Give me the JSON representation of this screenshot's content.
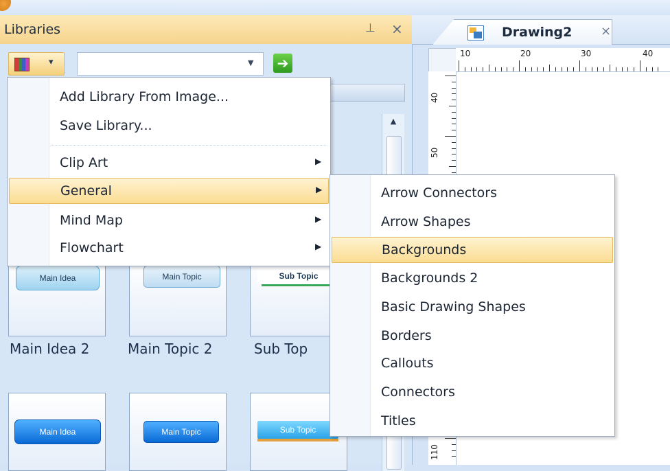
{
  "libraries_panel": {
    "title": "Libraries",
    "pin_icon": "pin-icon",
    "close_icon": "close-icon",
    "toolbar": {
      "library_icon": "library-icon",
      "search_value": "",
      "go_icon": "go-arrow-icon"
    }
  },
  "library_tiles": {
    "row1": [
      {
        "shape_text": "Main Idea"
      },
      {
        "shape_text": "Main Topic"
      },
      {
        "shape_text": "Sub Topic"
      }
    ],
    "row1_labels": [
      "Main Idea 2",
      "Main Topic 2",
      "Sub Top"
    ],
    "row2": [
      {
        "shape_text": "Main Idea"
      },
      {
        "shape_text": "Main Topic"
      },
      {
        "shape_text": "Sub Topic"
      }
    ]
  },
  "context_menu": {
    "items": [
      {
        "label": "Add Library From Image...",
        "submenu": false
      },
      {
        "label": "Save Library...",
        "submenu": false
      },
      {
        "label": "Clip Art",
        "submenu": true
      },
      {
        "label": "General",
        "submenu": true,
        "highlighted": true
      },
      {
        "label": "Mind Map",
        "submenu": true
      },
      {
        "label": "Flowchart",
        "submenu": true
      }
    ]
  },
  "general_submenu": {
    "items": [
      {
        "label": "Arrow Connectors"
      },
      {
        "label": "Arrow Shapes"
      },
      {
        "label": "Backgrounds",
        "highlighted": true
      },
      {
        "label": "Backgrounds 2"
      },
      {
        "label": "Basic Drawing Shapes"
      },
      {
        "label": "Borders"
      },
      {
        "label": "Callouts"
      },
      {
        "label": "Connectors"
      },
      {
        "label": "Titles"
      }
    ]
  },
  "document_tab": {
    "title": "Drawing2",
    "close_glyph": "×"
  },
  "ruler": {
    "horizontal_labels": [
      "10",
      "20",
      "30",
      "40"
    ],
    "vertical_labels": [
      "40",
      "50",
      "110"
    ]
  },
  "colors": {
    "highlight": "#fbdc92",
    "panel_header": "#f6d48c",
    "panel_bg": "#d7e6f7"
  }
}
